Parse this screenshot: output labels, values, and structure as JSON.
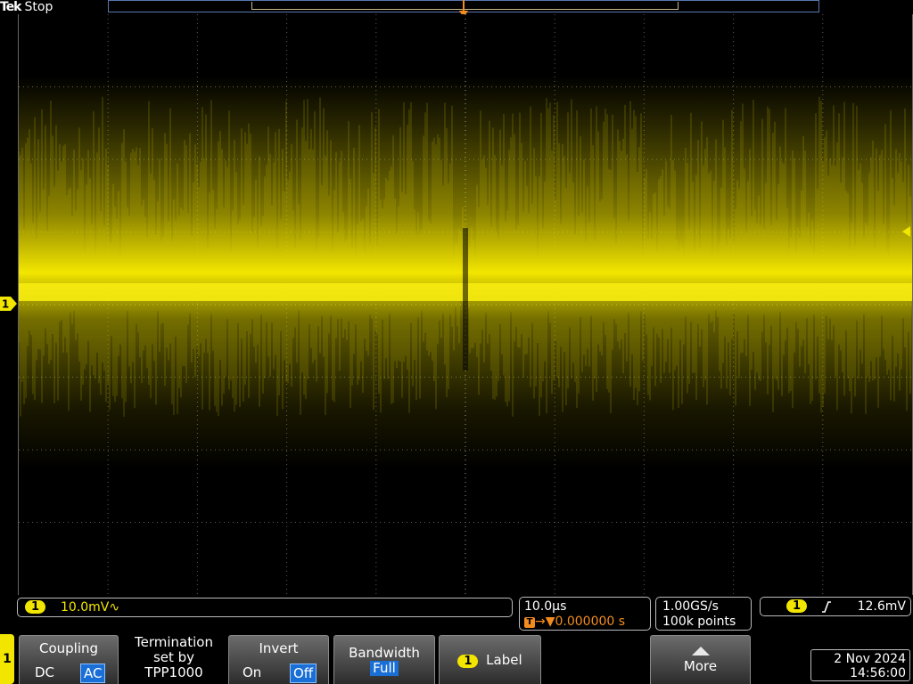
{
  "header": {
    "brand": "Tek",
    "acq_state": "Stop"
  },
  "trigger_marker": "T",
  "channel_marker": "1",
  "channel_readout": {
    "channel": "1",
    "scale": "10.0mV",
    "coupling_symbol": "∿"
  },
  "timebase": {
    "scale": "10.0µs",
    "position_icon": "T",
    "position": "0.000000 s"
  },
  "acquisition": {
    "sample_rate": "1.00GS/s",
    "record_length": "100k points"
  },
  "trigger": {
    "source": "1",
    "slope_icon": "rising-edge-icon",
    "level": "12.6mV"
  },
  "side_tab": "1",
  "menu": {
    "coupling": {
      "title": "Coupling",
      "options": [
        "DC",
        "AC"
      ],
      "selected": "AC"
    },
    "termination": {
      "line1": "Termination",
      "line2": "set by",
      "line3": "TPP1000"
    },
    "invert": {
      "title": "Invert",
      "options": [
        "On",
        "Off"
      ],
      "selected": "Off"
    },
    "bandwidth": {
      "title": "Bandwidth",
      "value": "Full"
    },
    "label": {
      "channel": "1",
      "text": "Label"
    },
    "more": {
      "text": "More"
    }
  },
  "datetime": {
    "date": "2 Nov 2024",
    "time": "14:56:00"
  },
  "colors": {
    "channel1": "#f2e600",
    "trigger": "#f28c1e",
    "selected": "#1a6fd6"
  }
}
